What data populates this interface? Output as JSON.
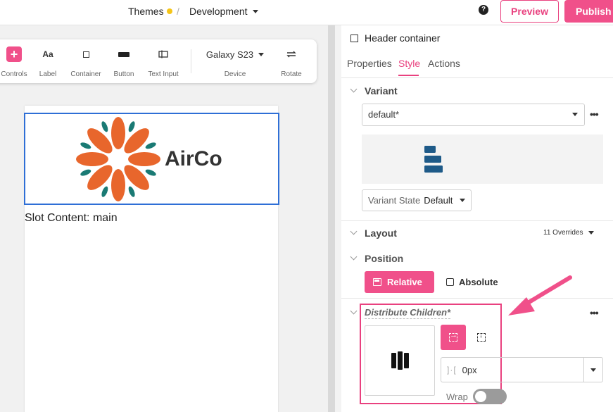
{
  "topbar": {
    "themes_label": "Themes",
    "separator": "/",
    "env_label": "Development",
    "help_icon": "?",
    "preview_label": "Preview",
    "publish_label": "Publish"
  },
  "toolbar": {
    "controls_label": "Controls",
    "label_label": "Label",
    "label_icon_text": "Aa",
    "container_label": "Container",
    "button_label": "Button",
    "textinput_label": "Text Input",
    "device_value": "Galaxy S23",
    "device_label": "Device",
    "rotate_label": "Rotate"
  },
  "canvas": {
    "brand_text": "AirCo",
    "slot_text": "Slot Content: main"
  },
  "panel": {
    "component_title": "Header container",
    "tabs": [
      "Properties",
      "Style",
      "Actions"
    ],
    "variant": {
      "title": "Variant",
      "value": "default*",
      "state_label": "Variant State",
      "state_value": "Default"
    },
    "layout": {
      "title": "Layout",
      "overrides": "11 Overrides"
    },
    "position": {
      "title": "Position",
      "relative_label": "Relative",
      "absolute_label": "Absolute"
    },
    "distribute": {
      "title": "Distribute Children*",
      "gap_value": "0px",
      "wrap_label": "Wrap"
    }
  },
  "colors": {
    "accent": "#f0508a",
    "selection": "#2f6fd6",
    "logo_orange": "#e8662c",
    "logo_teal": "#1a7a74"
  }
}
